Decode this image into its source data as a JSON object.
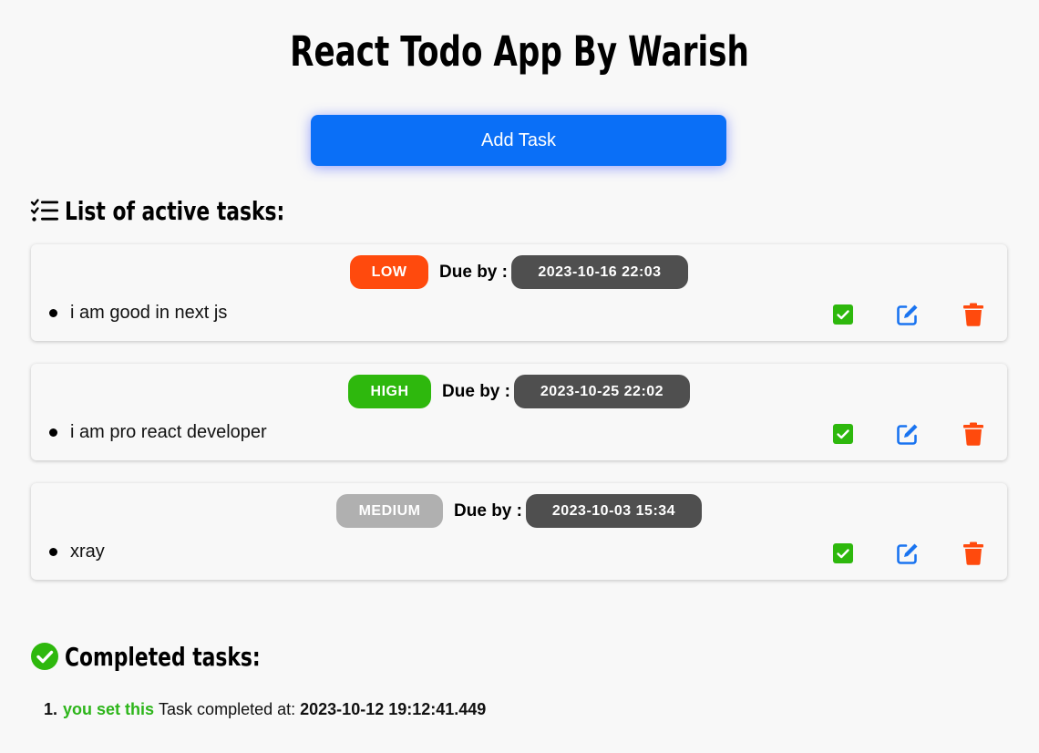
{
  "app": {
    "title": "React Todo App By Warish",
    "add_button_label": "Add Task"
  },
  "active_section": {
    "heading": "List of active tasks:",
    "icon": "list-check-icon",
    "tasks": [
      {
        "priority": "LOW",
        "priority_color": "#ff4a0d",
        "due_label": "Due by :",
        "due": "2023-10-16 22:03",
        "text": "i am good in next js"
      },
      {
        "priority": "HIGH",
        "priority_color": "#2eb80d",
        "due_label": "Due by :",
        "due": "2023-10-25 22:02",
        "text": "i am pro react developer"
      },
      {
        "priority": "MEDIUM",
        "priority_color": "#b0b0b0",
        "due_label": "Due by :",
        "due": "2023-10-03 15:34",
        "text": "xray"
      }
    ]
  },
  "completed_section": {
    "heading": "Completed tasks:",
    "icon": "check-circle-icon",
    "items": [
      {
        "number": "1.",
        "task": "you set this",
        "label": "Task completed at:",
        "timestamp": "2023-10-12 19:12:41.449"
      }
    ]
  },
  "colors": {
    "accent_blue": "#0a6ff7",
    "complete_green": "#2eb80d",
    "delete_orange": "#ff4a0d",
    "due_pill": "#4f4f4f"
  }
}
